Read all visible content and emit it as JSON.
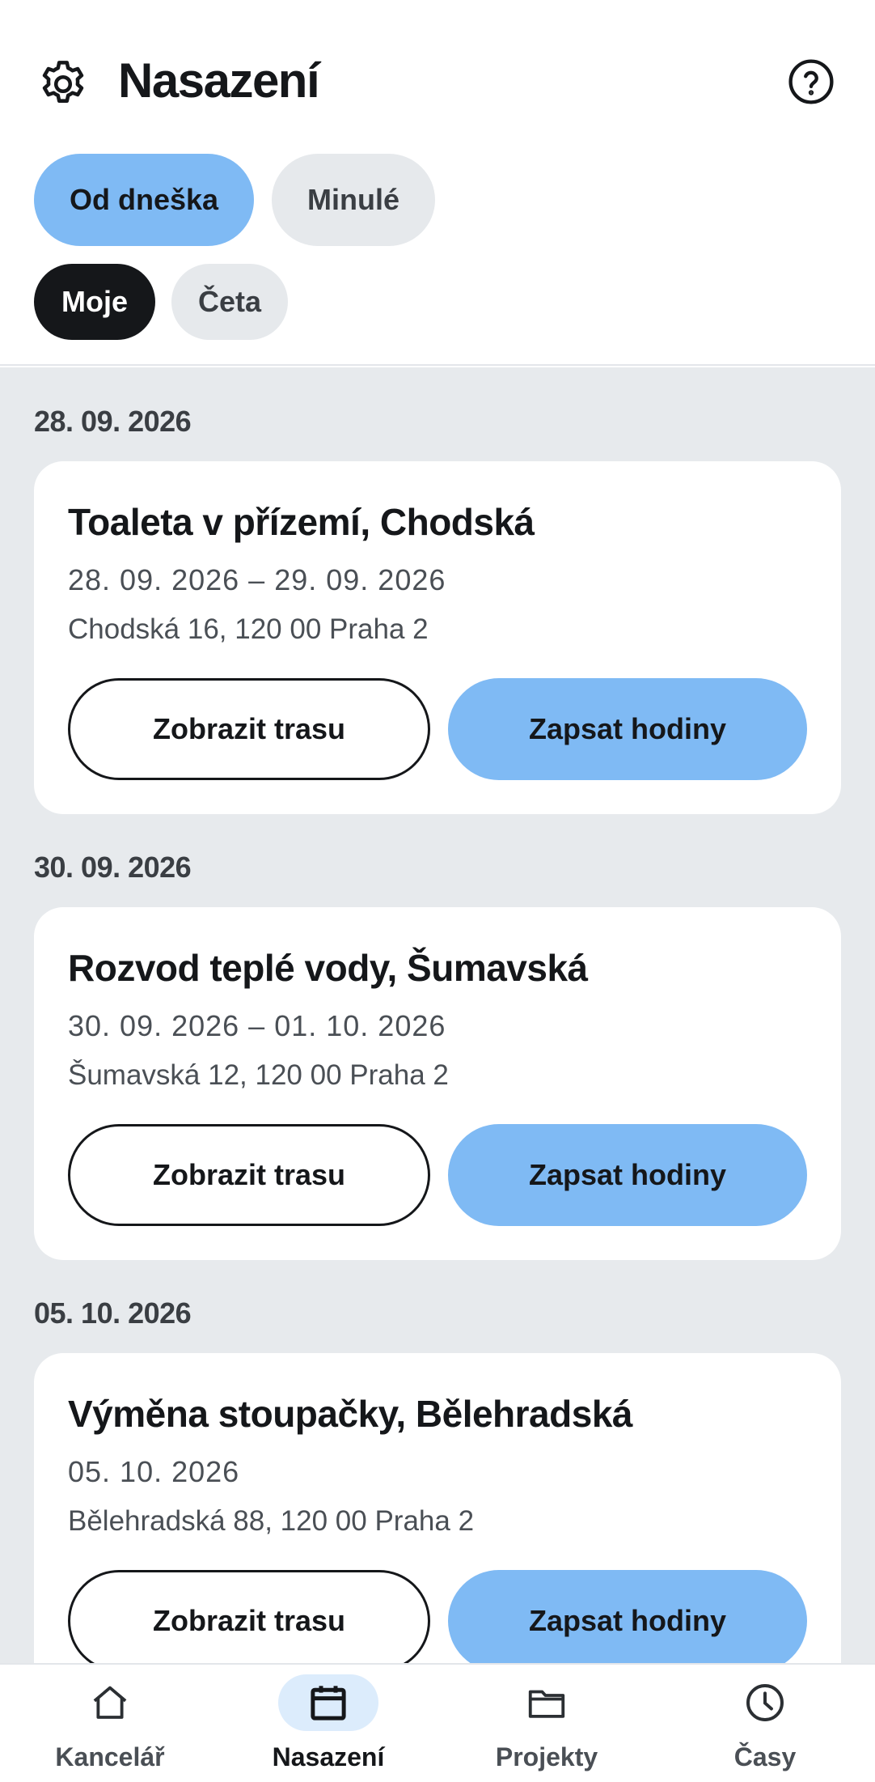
{
  "header": {
    "title": "Nasazení",
    "settings_icon": "gear-icon",
    "help_icon": "help-icon"
  },
  "filters": {
    "time": [
      {
        "label": "Od dneška",
        "active": true
      },
      {
        "label": "Minulé",
        "active": false
      }
    ],
    "scope": [
      {
        "label": "Moje",
        "active": true
      },
      {
        "label": "Četa",
        "active": false
      }
    ]
  },
  "groups": [
    {
      "date": "28. 09. 2026",
      "job": {
        "title": "Toaleta v přízemí, Chodská",
        "dates": "28. 09. 2026 – 29. 09. 2026",
        "address": "Chodská 16, 120 00 Praha 2",
        "route_label": "Zobrazit trasu",
        "hours_label": "Zapsat hodiny"
      }
    },
    {
      "date": "30. 09. 2026",
      "job": {
        "title": "Rozvod teplé vody, Šumavská",
        "dates": "30. 09. 2026 – 01. 10. 2026",
        "address": "Šumavská 12, 120 00 Praha 2",
        "route_label": "Zobrazit trasu",
        "hours_label": "Zapsat hodiny"
      }
    },
    {
      "date": "05. 10. 2026",
      "job": {
        "title": "Výměna stoupačky, Bělehradská",
        "dates": "05. 10. 2026",
        "address": "Bělehradská 88, 120 00 Praha 2",
        "route_label": "Zobrazit trasu",
        "hours_label": "Zapsat hodiny"
      }
    }
  ],
  "bottom_nav": [
    {
      "label": "Kancelář",
      "icon": "home-icon",
      "active": false
    },
    {
      "label": "Nasazení",
      "icon": "calendar-icon",
      "active": true
    },
    {
      "label": "Projekty",
      "icon": "folder-icon",
      "active": false
    },
    {
      "label": "Časy",
      "icon": "clock-icon",
      "active": false
    }
  ],
  "colors": {
    "accent": "#7fbaf4",
    "accent_light": "#dcecfc",
    "dark": "#15171a",
    "list_background": "#e7eaed",
    "chip_inactive": "#e6e9ec"
  }
}
